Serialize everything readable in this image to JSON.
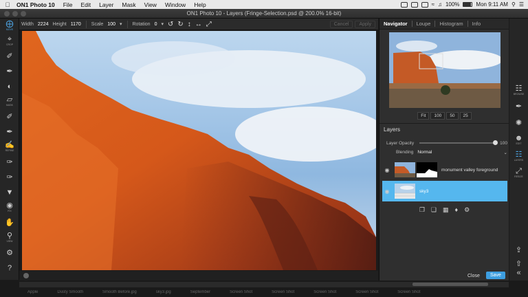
{
  "menubar": {
    "app": "ON1 Photo 10",
    "items": [
      "File",
      "Edit",
      "Layer",
      "Mask",
      "View",
      "Window",
      "Help"
    ],
    "battery": "100%",
    "clock": "Mon 9:11 AM"
  },
  "window": {
    "title": "ON1 Photo 10 - Layers (Fringe-Selection.psd @ 200.0% 16-bit)"
  },
  "options": {
    "width_label": "Width",
    "width_value": "2224",
    "height_label": "Height",
    "height_value": "1170",
    "scale_label": "Scale",
    "scale_value": "100",
    "rotation_label": "Rotation",
    "rotation_value": "0",
    "cancel": "Cancel",
    "apply": "Apply"
  },
  "tools": [
    {
      "icon": "move-icon",
      "label": "MOVE"
    },
    {
      "icon": "crop-icon",
      "label": "CROP"
    },
    {
      "icon": "brush-icon",
      "label": ""
    },
    {
      "icon": "brush-icon",
      "label": ""
    },
    {
      "icon": "adjust-icon",
      "label": ""
    },
    {
      "icon": "mask-icon",
      "label": "MASK"
    },
    {
      "icon": "brush-icon",
      "label": ""
    },
    {
      "icon": "brush-icon",
      "label": ""
    },
    {
      "icon": "refine-icon",
      "label": "REFINE"
    },
    {
      "icon": "pen-icon",
      "label": ""
    },
    {
      "icon": "dropper-icon",
      "label": ""
    },
    {
      "icon": "stamp-icon",
      "label": ""
    },
    {
      "icon": "eye-icon",
      "label": "FIX"
    },
    {
      "icon": "hand-icon",
      "label": ""
    },
    {
      "icon": "zoom-icon",
      "label": "VIEW"
    },
    {
      "icon": "gear-icon",
      "label": ""
    },
    {
      "icon": "help-icon",
      "label": ""
    },
    {
      "icon": "collapse-icon",
      "label": ""
    }
  ],
  "panel": {
    "tabs": [
      "Navigator",
      "Loupe",
      "Histogram",
      "Info"
    ],
    "zoom": [
      "Fit",
      "100",
      "50",
      "25"
    ],
    "layers_title": "Layers",
    "opacity_label": "Layer Opacity",
    "opacity_value": "100",
    "blending_label": "Blending",
    "blending_value": "Normal",
    "layers": [
      {
        "name": "monument valley foreground"
      },
      {
        "name": "sky3"
      }
    ],
    "close": "Close",
    "save": "Save"
  },
  "modules": [
    {
      "icon": "browse-icon",
      "label": "BROWSE"
    },
    {
      "icon": "develop-icon",
      "label": ""
    },
    {
      "icon": "effects-icon",
      "label": ""
    },
    {
      "icon": "portrait-icon",
      "label": "EDIT"
    },
    {
      "icon": "layers-icon",
      "label": "LAYERS"
    },
    {
      "icon": "resize-icon",
      "label": "RESIZE"
    }
  ],
  "dock": [
    "Apple",
    "Dusty Smooth",
    "Smooth Before.jpg",
    "sky3.jpg",
    "September",
    "Screen Shot",
    "Screen Shot",
    "Screen Shot",
    "Screen Shot",
    "Screen Shot"
  ]
}
